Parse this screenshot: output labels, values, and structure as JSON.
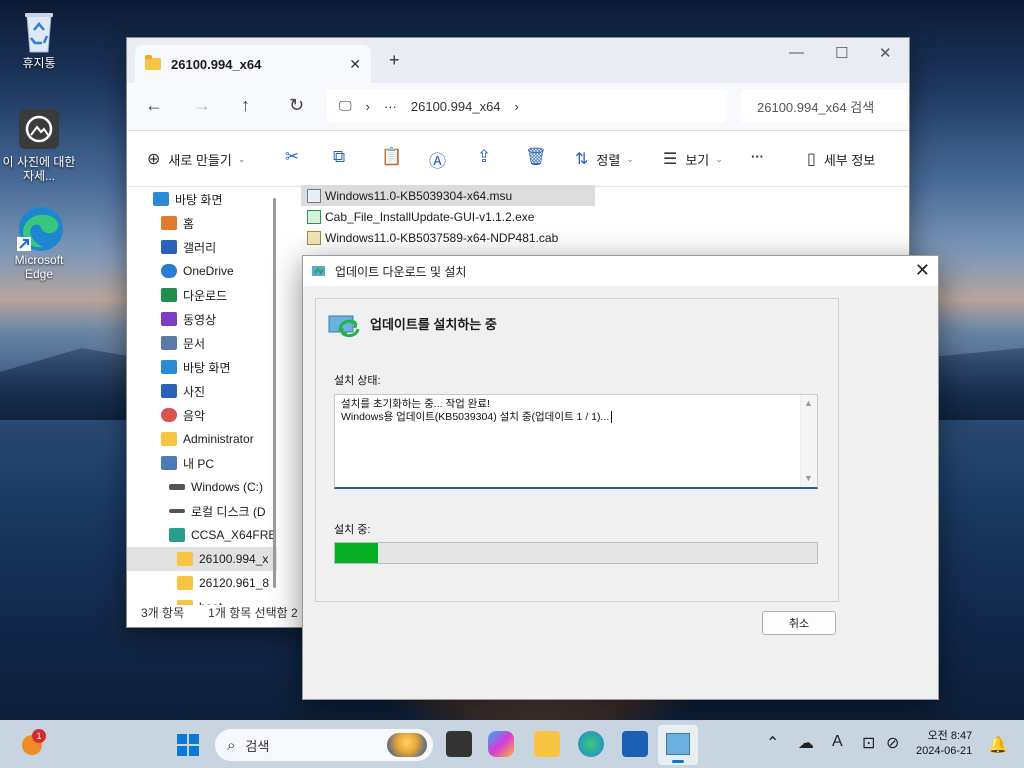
{
  "desktop": {
    "icons": [
      {
        "label": "휴지통",
        "icon": "recycle-bin-icon"
      },
      {
        "label": "이 사진에 대한 자세...",
        "icon": "camera-info-icon"
      },
      {
        "label": "Microsoft Edge",
        "icon": "edge-icon"
      }
    ]
  },
  "explorer": {
    "tab_title": "26100.994_x64",
    "address": {
      "ellipsis": "···",
      "path": "26100.994_x64"
    },
    "search_placeholder": "26100.994_x64 검색",
    "toolbar": {
      "new": "새로 만들기",
      "sort": "정렬",
      "view": "보기",
      "more": "···",
      "details": "세부 정보"
    },
    "sidebar": [
      {
        "label": "바탕 화면",
        "color": "#2b8ad6"
      },
      {
        "label": "홈",
        "color": "#e07a2e"
      },
      {
        "label": "갤러리",
        "color": "#2a62b8"
      },
      {
        "label": "OneDrive",
        "color": "#2b7cd3"
      },
      {
        "label": "다운로드",
        "color": "#1f8f4e"
      },
      {
        "label": "동영상",
        "color": "#7b3fc4"
      },
      {
        "label": "문서",
        "color": "#5b7aa8"
      },
      {
        "label": "바탕 화면",
        "color": "#2b8ad6"
      },
      {
        "label": "사진",
        "color": "#2a62b8"
      },
      {
        "label": "음악",
        "color": "#d9534f"
      },
      {
        "label": "Administrator",
        "color": "#f8c542"
      },
      {
        "label": "내 PC",
        "color": "#4a7bb7"
      },
      {
        "label": "Windows (C:)",
        "color": "#555555"
      },
      {
        "label": "로컬 디스크 (D",
        "color": "#555555"
      },
      {
        "label": "CCSA_X64FRE",
        "color": "#2a9d8f"
      },
      {
        "label": "26100.994_x",
        "color": "#f8c542"
      },
      {
        "label": "26120.961_8",
        "color": "#f8c542"
      },
      {
        "label": "boot",
        "color": "#f8c542"
      }
    ],
    "files": [
      {
        "name": "Windows11.0-KB5039304-x64.msu"
      },
      {
        "name": "Cab_File_InstallUpdate-GUI-v1.1.2.exe"
      },
      {
        "name": "Windows11.0-KB5037589-x64-NDP481.cab"
      }
    ],
    "status": {
      "count": "3개 항목",
      "selected": "1개 항목 선택함 2"
    }
  },
  "dialog": {
    "title": "업데이트 다운로드 및 설치",
    "heading": "업데이트를 설치하는 중",
    "status_label": "설치 상태:",
    "log_line1": "설치를 초기화하는 중... 작업 완료!",
    "log_line2": "Windows용 업데이트(KB5039304) 설치 중(업데이트 1 / 1)...",
    "progress_label": "설치 중:",
    "progress_fraction": 0.09,
    "cancel": "취소"
  },
  "taskbar": {
    "search": "검색",
    "notification_count": "1",
    "time": "오전 8:47",
    "date": "2024-06-21"
  }
}
